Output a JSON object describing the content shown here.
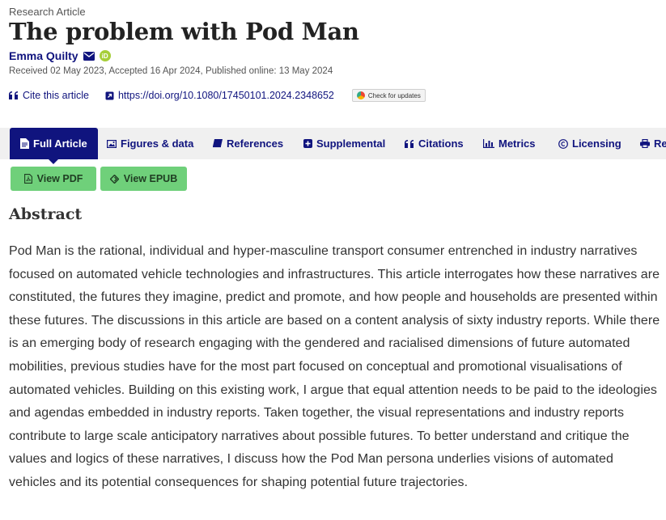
{
  "article": {
    "type": "Research Article",
    "title": "The problem with Pod Man",
    "author": "Emma Quilty",
    "dates": "Received 02 May 2023, Accepted 16 Apr 2024, Published online: 13 May 2024"
  },
  "links": {
    "cite": "Cite this article",
    "doi": "https://doi.org/10.1080/17450101.2024.2348652",
    "check_updates": "Check for updates"
  },
  "tabs": [
    {
      "label": "Full Article",
      "icon": "document-icon"
    },
    {
      "label": "Figures & data",
      "icon": "image-icon"
    },
    {
      "label": "References",
      "icon": "book-icon"
    },
    {
      "label": "Supplemental",
      "icon": "plus-square-icon"
    },
    {
      "label": "Citations",
      "icon": "quote-icon"
    },
    {
      "label": "Metrics",
      "icon": "bar-chart-icon"
    },
    {
      "label": "Licensing",
      "icon": "copyright-icon"
    },
    {
      "label": "Re",
      "icon": "print-icon"
    }
  ],
  "buttons": {
    "view_pdf": "View PDF",
    "view_epub": "View EPUB"
  },
  "abstract": {
    "heading": "Abstract",
    "text": "Pod Man is the rational, individual and hyper-masculine transport consumer entrenched in industry narratives focused on automated vehicle technologies and infrastructures. This article interrogates how these narratives are constituted, the futures they imagine, predict and promote, and how people and households are presented within these futures. The discussions in this article are based on a content analysis of sixty industry reports. While there is an emerging body of research engaging with the gendered and racialised dimensions of future automated mobilities, previous studies have for the most part focused on conceptual and promotional visualisations of automated vehicles. Building on this existing work, I argue that equal attention needs to be paid to the ideologies and agendas embedded in industry reports. Taken together, the visual representations and industry reports contribute to large scale anticipatory narratives about possible futures. To better understand and critique the values and logics of these narratives, I discuss how the Pod Man persona underlies visions of automated vehicles and its potential consequences for shaping potential future trajectories."
  },
  "colors": {
    "brand": "#10147e",
    "tab_bar": "#f0f0f0",
    "button_green": "#6fd07a",
    "orcid": "#a6ce39"
  }
}
